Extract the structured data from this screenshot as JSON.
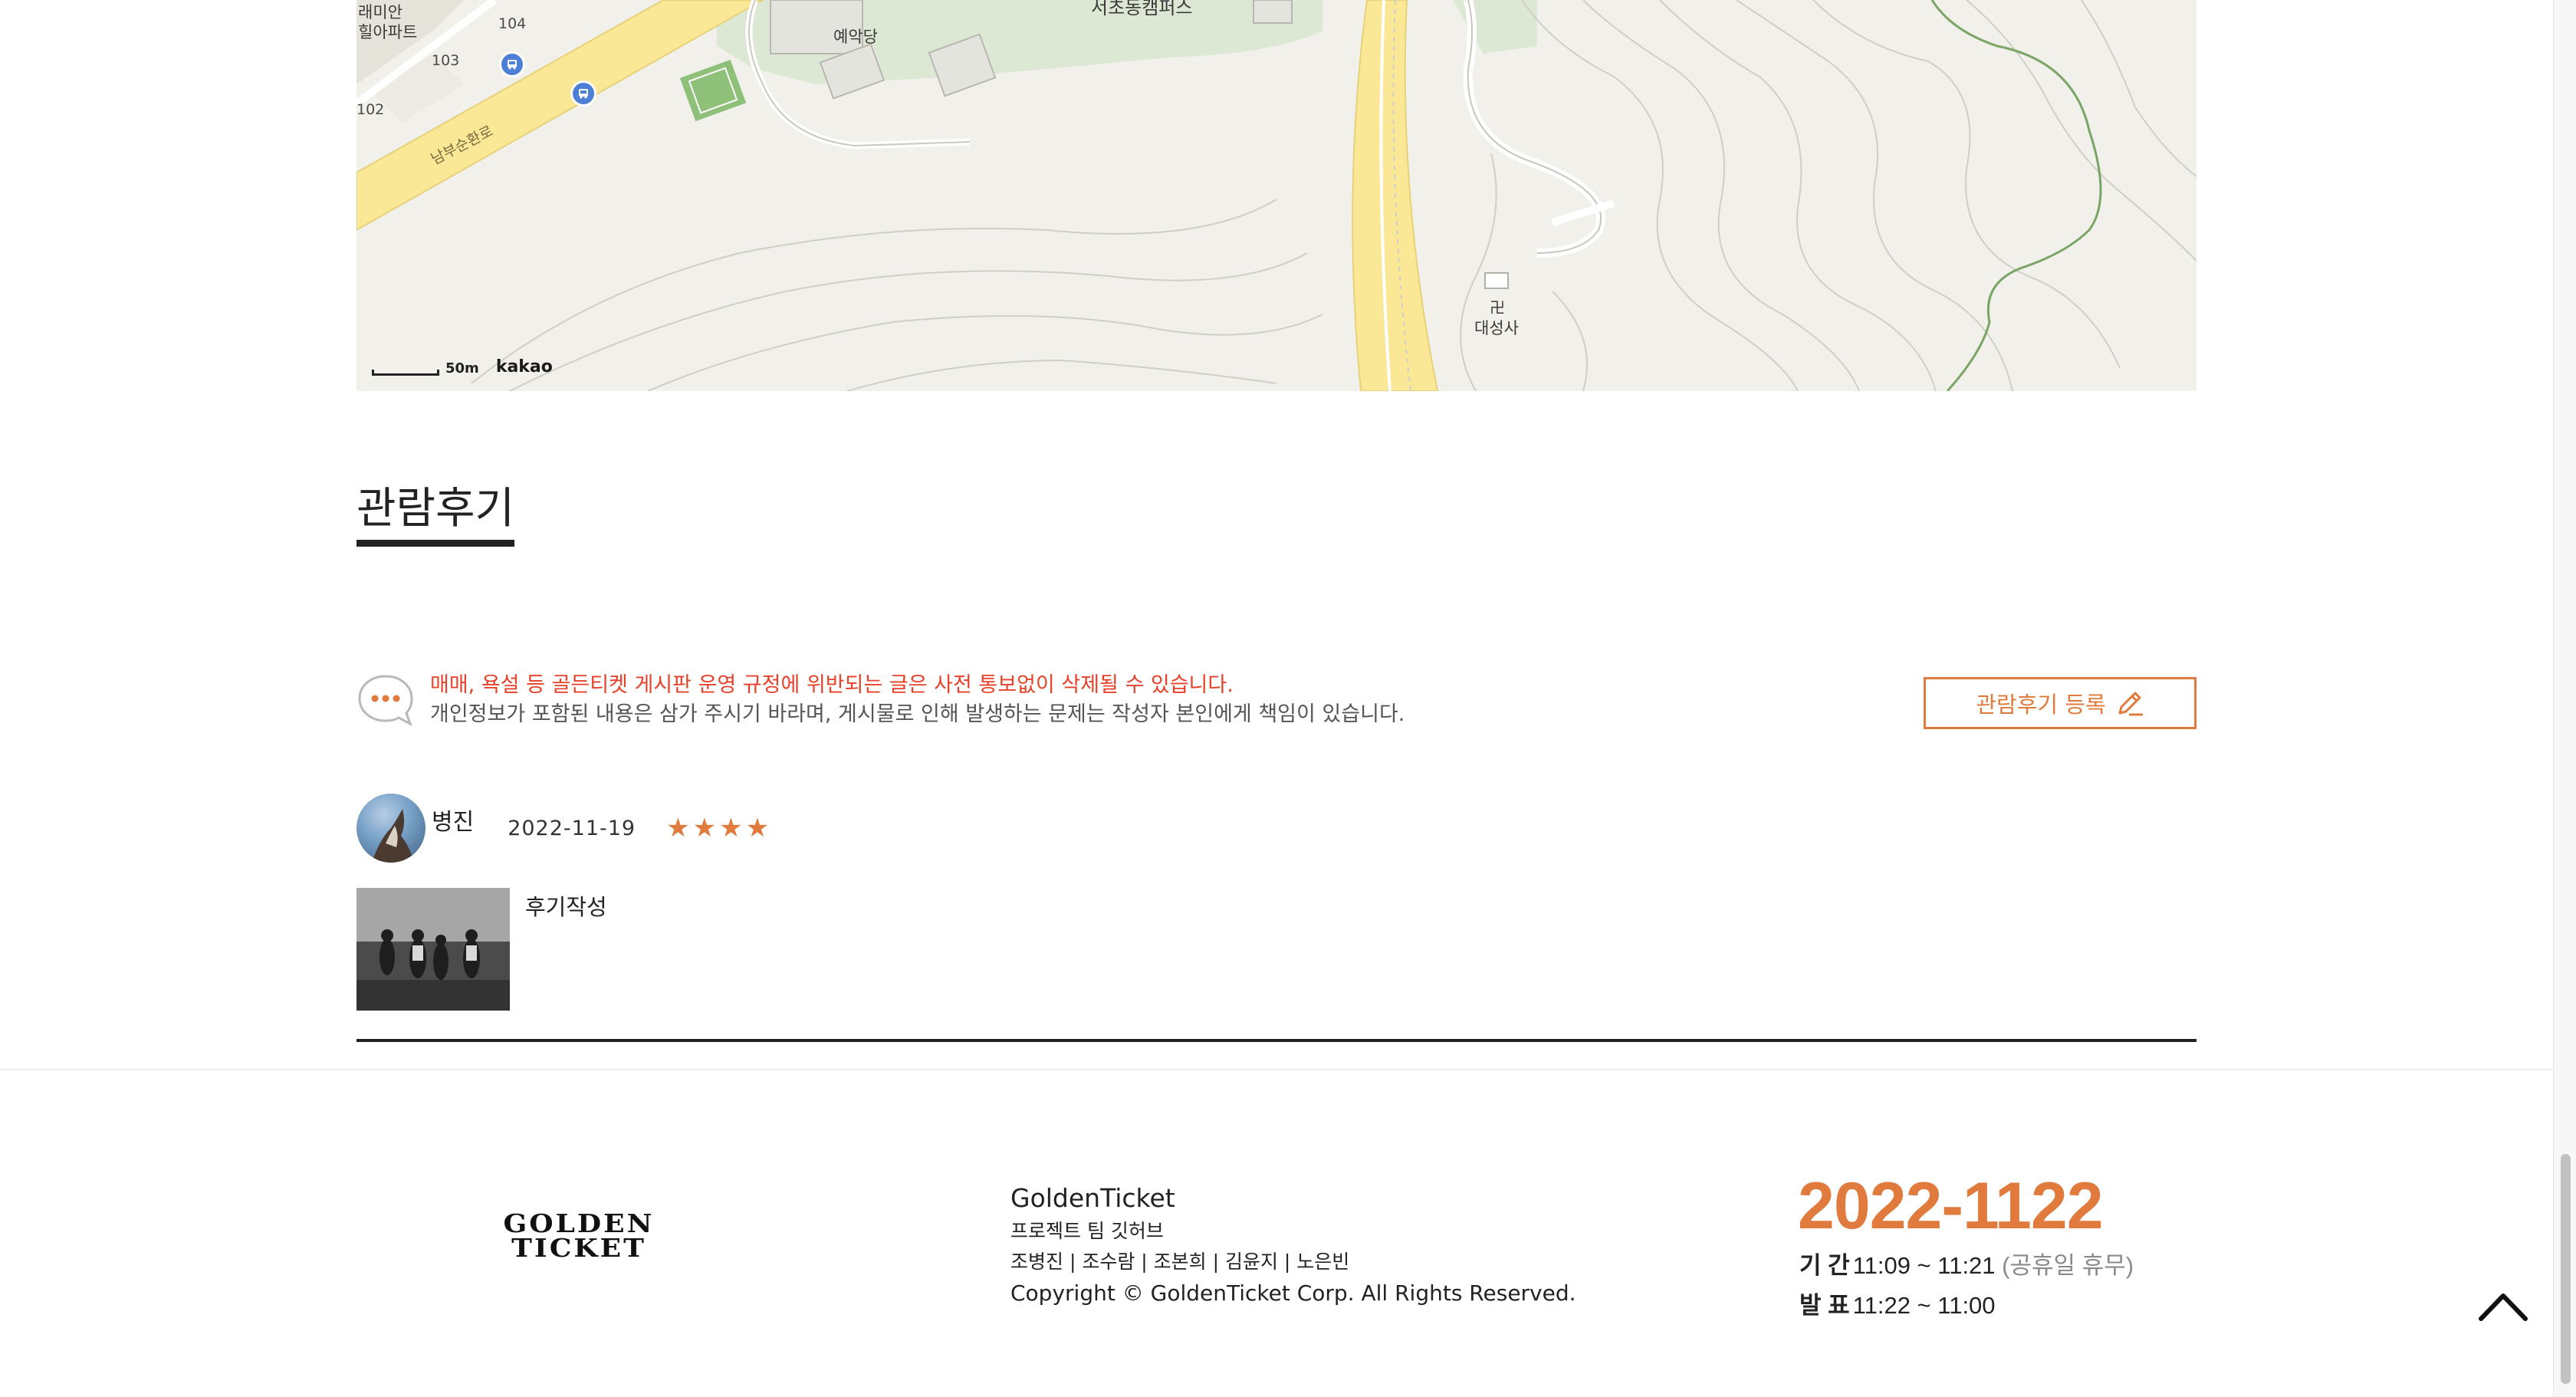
{
  "map": {
    "labels": {
      "apt_name_1": "래미안",
      "apt_name_2": "힐아파트",
      "bldg_104": "104",
      "bldg_103": "103",
      "bldg_102": "102",
      "yeakdang": "예악당",
      "campus": "서초동캠퍼스",
      "road": "남부순환로",
      "temple": "대성사"
    },
    "scale_text": "50m",
    "provider_logo": "kakao"
  },
  "review_section": {
    "title": "관람후기",
    "notice_warning": "매매, 욕설 등 골든티켓 게시판 운영 규정에 위반되는 글은 사전 통보없이 삭제될 수 있습니다.",
    "notice_info": "개인정보가 포함된 내용은 삼가 주시기 바라며, 게시물로 인해 발생하는 문제는 작성자 본인에게 책임이 있습니다.",
    "write_button_label": "관람후기 등록",
    "reviews": [
      {
        "author": "병진",
        "date": "2022-11-19",
        "rating": 4,
        "text": "후기작성"
      }
    ]
  },
  "footer": {
    "logo_line1": "GOLDEN",
    "logo_line2": "TICKET",
    "brand": "GoldenTicket",
    "team": "프로젝트 팀 깃허브",
    "members": "조병진 | 조수람 | 조본희 | 김윤지 | 노은빈",
    "copyright": "Copyright © GoldenTicket Corp. All Rights Reserved.",
    "date_big": "2022-1122",
    "period_label": "기 간",
    "period_value": "11:09 ~ 11:21",
    "period_note": "(공휴일 휴무)",
    "announce_label": "발 표",
    "announce_value": "11:22 ~ 11:00"
  },
  "colors": {
    "accent": "#e07a3d",
    "warning": "#e8412a",
    "map_bg": "#f1f0ea",
    "road_yellow": "#fbe897"
  },
  "icons": {
    "notice": "speech-bubble-dots-icon",
    "write": "pencil-icon",
    "scroll_top": "chevron-up-icon",
    "bus": "bus-stop-icon",
    "temple": "temple-icon"
  }
}
